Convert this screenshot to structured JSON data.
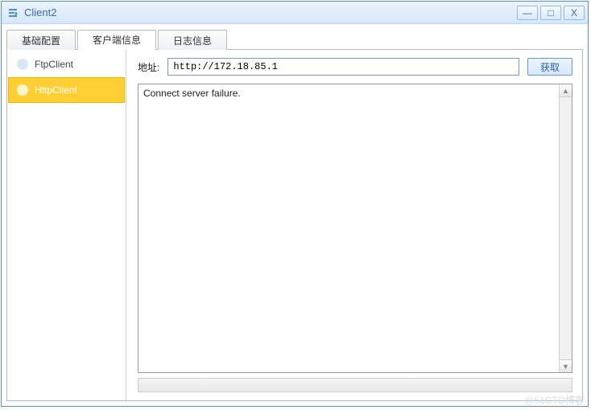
{
  "window": {
    "title": "Client2",
    "buttons": {
      "min": "—",
      "max": "□",
      "close": "X"
    }
  },
  "tabs": [
    {
      "id": "basic",
      "label": "基础配置",
      "active": false
    },
    {
      "id": "clients",
      "label": "客户端信息",
      "active": true
    },
    {
      "id": "logs",
      "label": "日志信息",
      "active": false
    }
  ],
  "sidebar": {
    "items": [
      {
        "id": "ftp",
        "label": "FtpClient",
        "selected": false
      },
      {
        "id": "http",
        "label": "HttpClient",
        "selected": true
      }
    ]
  },
  "main": {
    "address_label": "地址:",
    "address_value": "http://172.18.85.1",
    "fetch_label": "获取",
    "output": "Connect server failure."
  },
  "watermark": "@51CTO博客"
}
